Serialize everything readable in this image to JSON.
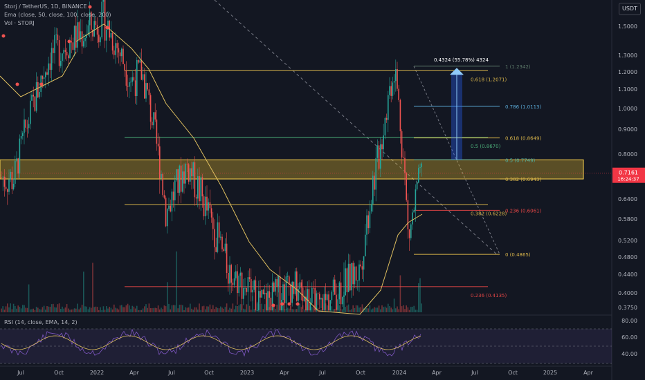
{
  "header": {
    "symbol_line": "Storj / TetherUS, 1D, BINANCE",
    "ema_line": "Ema (close, 50, close, 100, close, 200)",
    "vol_line": "Vol · STORJ",
    "currency": "USDT"
  },
  "price_axis": {
    "ticks": [
      "1.5000",
      "1.3000",
      "1.2000",
      "1.1000",
      "1.0000",
      "0.9000",
      "0.8000",
      "0.7000",
      "0.6400",
      "0.5800",
      "0.5200",
      "0.4800",
      "0.4400",
      "0.4000",
      "0.3750"
    ],
    "current_price": "0.7161",
    "countdown": "16:24:37"
  },
  "time_axis": {
    "labels": [
      "Jul",
      "Oct",
      "2022",
      "Apr",
      "Jul",
      "Oct",
      "2023",
      "Apr",
      "Jul",
      "Oct",
      "2024",
      "Apr",
      "Jul",
      "Oct",
      "2025",
      "Apr"
    ]
  },
  "rsi": {
    "label": "RSI (14, close, EMA, 14, 2)",
    "ticks": [
      "80.00",
      "60.00",
      "40.00"
    ]
  },
  "fib_left": [
    {
      "label": "0.618 (1.2071)",
      "price": 1.2071,
      "color": "#d6b34a"
    },
    {
      "label": "0.5 (0.8670)",
      "price": 0.867,
      "color": "#4caf7a"
    },
    {
      "label": "0.382 (0.6228)",
      "price": 0.6228,
      "color": "#d6b34a"
    },
    {
      "label": "0.236 (0.4135)",
      "price": 0.4135,
      "color": "#e04545"
    }
  ],
  "fib_right": [
    {
      "label": "1 (1.2342)",
      "price": 1.2342,
      "color": "#5d7a6a"
    },
    {
      "label": "0.786 (1.0113)",
      "price": 1.0113,
      "color": "#5aa9d6"
    },
    {
      "label": "0.618 (0.8649)",
      "price": 0.8649,
      "color": "#d6b34a"
    },
    {
      "label": "0.5 (0.7749)",
      "price": 0.7749,
      "color": "#4fb0a0"
    },
    {
      "label": "0.382 (0.6943)",
      "price": 0.6943,
      "color": "#d6b34a"
    },
    {
      "label": "0.236 (0.6061)",
      "price": 0.6061,
      "color": "#e04545"
    },
    {
      "label": "0 (0.4865)",
      "price": 0.4865,
      "color": "#d6b34a"
    }
  ],
  "measure": {
    "label": "0.4324 (55.78%) 4324"
  },
  "colors": {
    "bg": "#131722",
    "up": "#26a69a",
    "down": "#ef5350",
    "ema": "#e0c060",
    "zone": "#ffcc33",
    "rsi": "#7e57c2",
    "rsi_line": "#e0c060",
    "price_tag": "#f23645"
  },
  "chart_data": {
    "type": "candlestick",
    "title": "Storj / TetherUS, 1D, BINANCE",
    "ylim": [
      0.375,
      1.5
    ],
    "series_keypoints": [
      {
        "x": "Jul 2021",
        "close": 0.7
      },
      {
        "x": "Sep 2021",
        "close": 1.3
      },
      {
        "x": "Dec 2021",
        "close": 1.55
      },
      {
        "x": "Feb 2022",
        "close": 1.15
      },
      {
        "x": "Apr 2022",
        "close": 1.2
      },
      {
        "x": "May 2022",
        "close": 0.6
      },
      {
        "x": "Jul 2022",
        "close": 0.75
      },
      {
        "x": "Oct 2022",
        "close": 0.45
      },
      {
        "x": "Jan 2023",
        "close": 0.38
      },
      {
        "x": "Apr 2023",
        "close": 0.42
      },
      {
        "x": "Jun 2023",
        "close": 0.37
      },
      {
        "x": "Oct 2023",
        "close": 0.45
      },
      {
        "x": "Nov 2023",
        "close": 0.8
      },
      {
        "x": "Dec 2023",
        "close": 1.24
      },
      {
        "x": "Jan 2024",
        "close": 0.52
      },
      {
        "x": "Mar 2024",
        "close": 0.7161
      }
    ],
    "resistance_zone": [
      0.6943,
      0.7749
    ]
  }
}
